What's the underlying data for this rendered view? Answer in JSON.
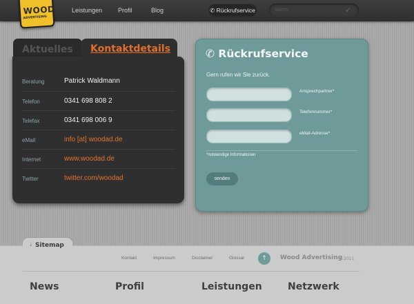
{
  "logo": {
    "word": "WOOD",
    "sub": "ADVERTISING"
  },
  "nav": {
    "links": [
      "Leistungen",
      "Profil",
      "Blog"
    ],
    "callback_label": "✆ Rückrufservice",
    "search_placeholder": "Suche"
  },
  "left_panel": {
    "tab_inactive": "Aktuelles",
    "tab_active": "Kontaktdetails",
    "rows": [
      {
        "label": "Beratung",
        "value": "Patrick Waldmann"
      },
      {
        "label": "Telefon",
        "value": "0341 698 808 2"
      },
      {
        "label": "Telefax",
        "value": "0341 698 006 9"
      },
      {
        "label": "eMail",
        "value": "info [at] woodad.de"
      },
      {
        "label": "Internet",
        "value": "www.woodad.de"
      },
      {
        "label": "Twitter",
        "value": "twitter.com/woodad"
      }
    ]
  },
  "right_panel": {
    "title": "✆ Rückrufservice",
    "intro": "Gern rufen wir Sie zurück.",
    "fields": [
      {
        "label": "Ansprechpartner*"
      },
      {
        "label": "Telefonnummer*"
      },
      {
        "label": "eMail-Adresse*"
      }
    ],
    "note": "*notwendige Informationen",
    "submit": "senden"
  },
  "footer": {
    "sitemap": "Sitemap",
    "sitemap_arrow": "↓",
    "links": [
      "Kontakt",
      "Impressum",
      "Disclaimer",
      "Glossar"
    ],
    "up": "↑",
    "brand": "Wood Advertising",
    "year": "©2011",
    "columns": [
      "News",
      "Profil",
      "Leistungen",
      "Netzwerk"
    ]
  },
  "colors": {
    "accent": "#e06f2b",
    "teal": "#6f9a9a",
    "dark": "#2f2f2f"
  }
}
